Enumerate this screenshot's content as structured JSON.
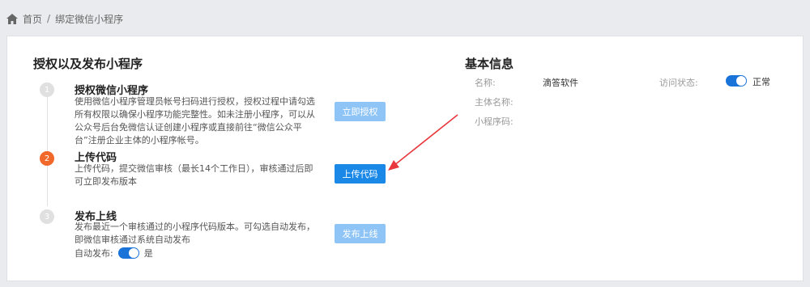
{
  "breadcrumb": {
    "home": "首页",
    "separator": "/",
    "current": "绑定微信小程序"
  },
  "left_section": {
    "title": "授权以及发布小程序",
    "steps": [
      {
        "number": "1",
        "title": "授权微信小程序",
        "desc": "使用微信小程序管理员帐号扫码进行授权，授权过程中请勾选所有权限以确保小程序功能完整性。如未注册小程序，可以从公众号后台免微信认证创建小程序或直接前往“微信公众平台”注册企业主体的小程序帐号。",
        "button": "立即授权"
      },
      {
        "number": "2",
        "title": "上传代码",
        "desc": "上传代码，提交微信审核（最长14个工作日），审核通过后即可立即发布版本",
        "button": "上传代码"
      },
      {
        "number": "3",
        "title": "发布上线",
        "desc": "发布最近一个审核通过的小程序代码版本。可勾选自动发布，即微信审核通过系统自动发布",
        "button": "发布上线"
      }
    ],
    "auto_publish": {
      "label": "自动发布:",
      "value": "是"
    }
  },
  "right_section": {
    "title": "基本信息",
    "name_label": "名称:",
    "name_value": "滴答软件",
    "entity_label": "主体名称:",
    "code_label": "小程序码:",
    "status_label": "访问状态:",
    "status_value": "正常"
  },
  "colors": {
    "primary": "#1a88e6",
    "primary_light": "#8fc4f6",
    "active_step": "#f0692a",
    "arrow": "#e8383d"
  }
}
